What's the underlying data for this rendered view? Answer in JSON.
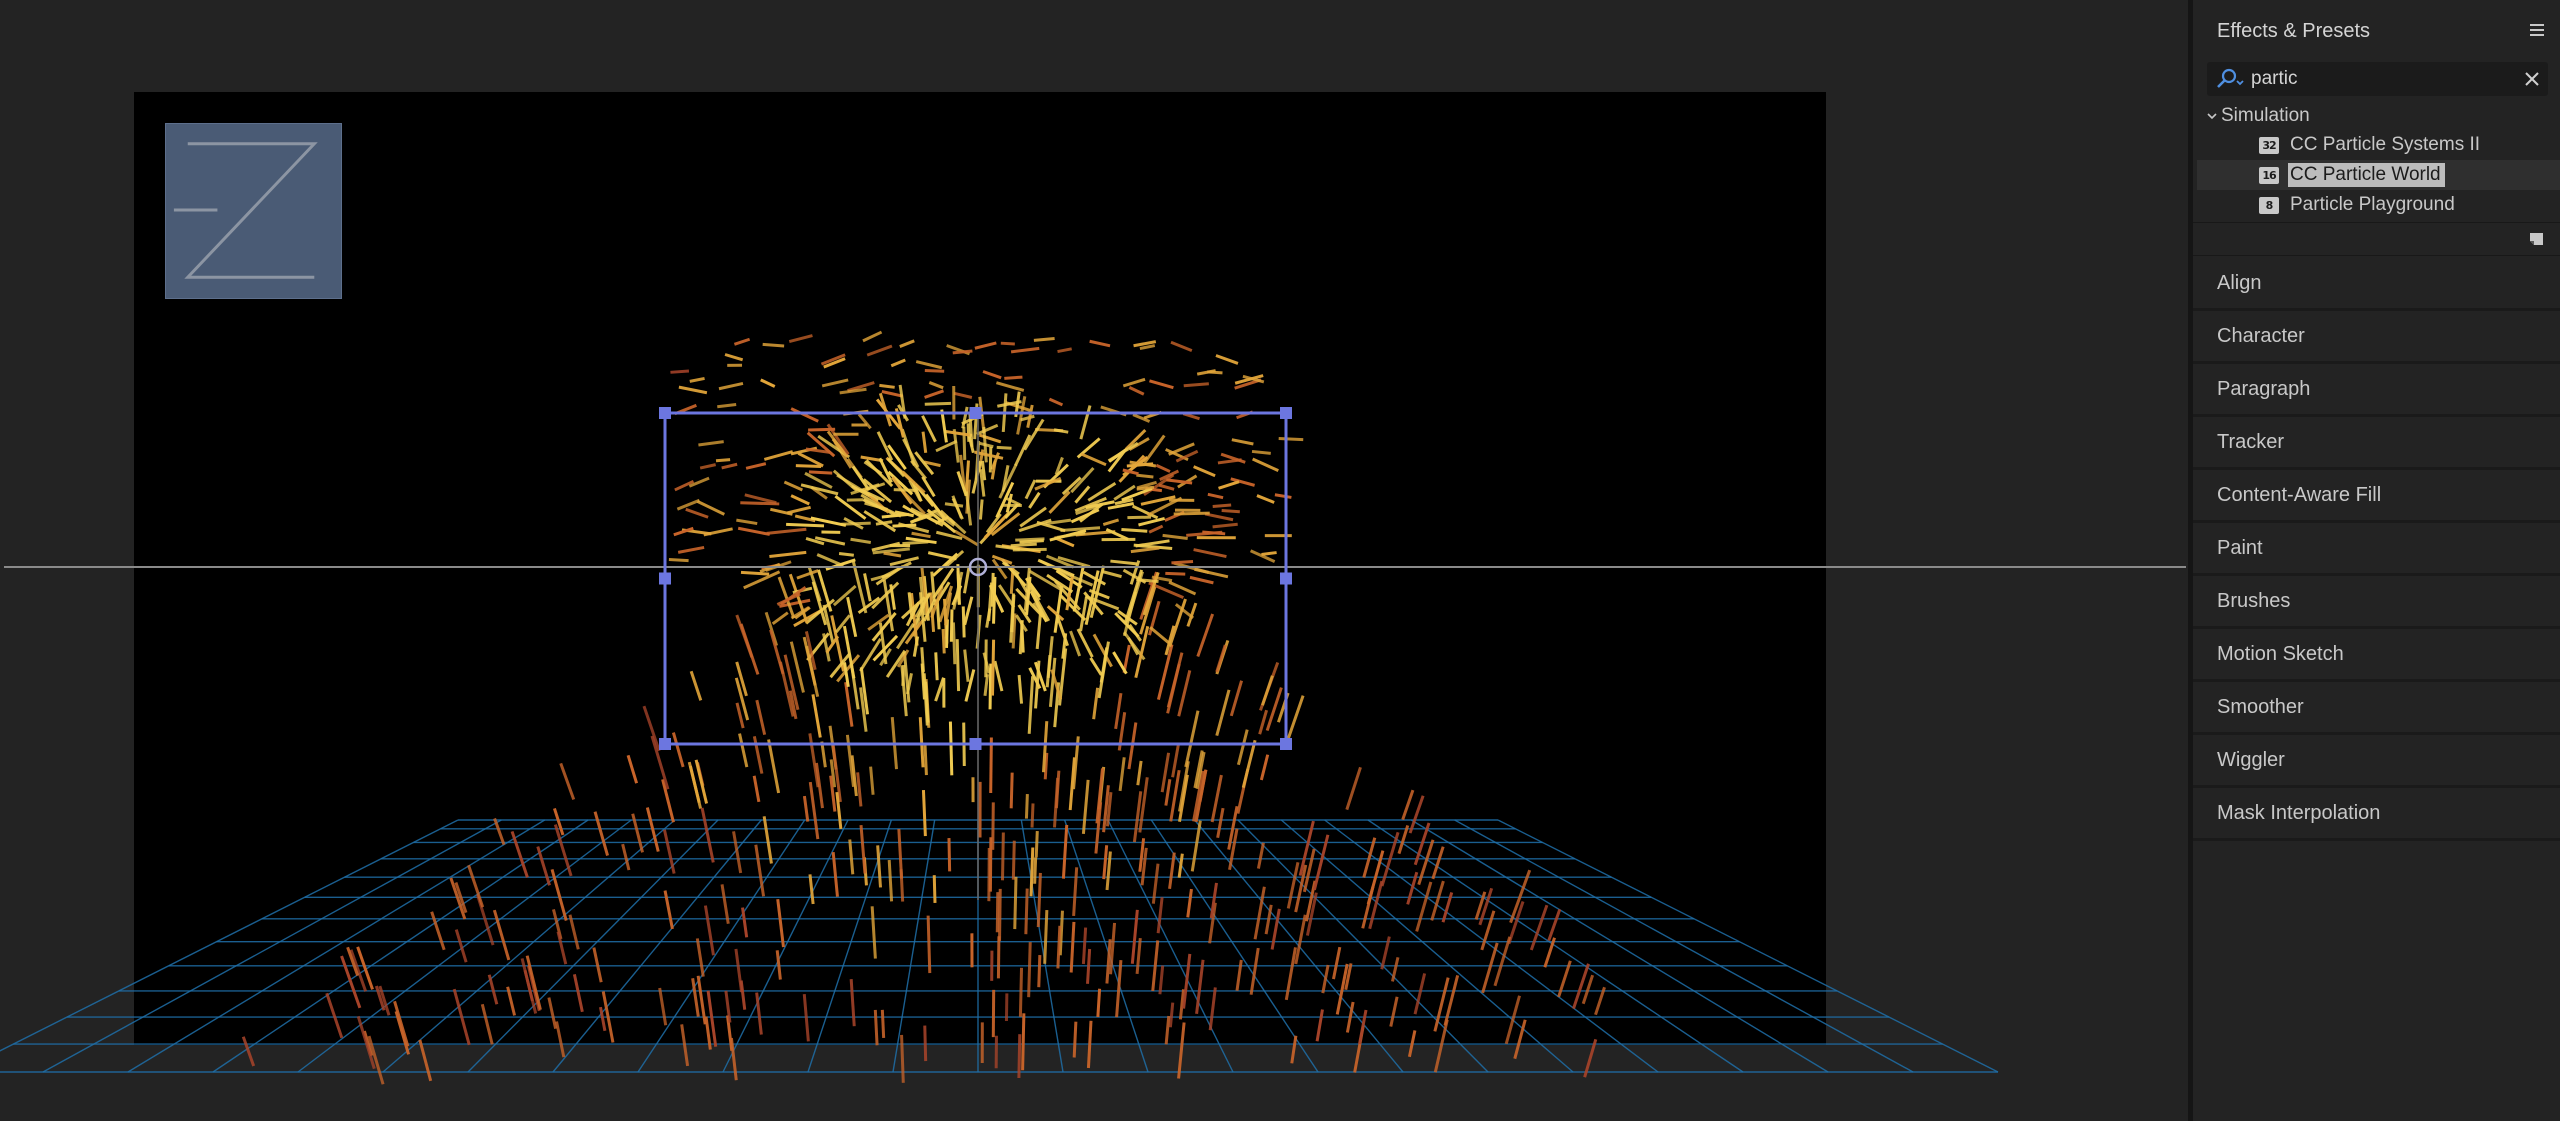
{
  "panel": {
    "title": "Effects & Presets",
    "menu_icon": "hamburger-icon",
    "search": {
      "value": "partic",
      "icon": "search-dropdown-icon",
      "clear_icon": "close-icon"
    },
    "tree": {
      "folder": "Simulation",
      "items": [
        {
          "label": "CC Particle Systems II",
          "badge": "32",
          "selected": false
        },
        {
          "label": "CC Particle World",
          "badge": "16",
          "selected": true
        },
        {
          "label": "Particle Playground",
          "badge": "8",
          "selected": false
        }
      ]
    },
    "footer_icon": "new-folder-icon"
  },
  "sections": [
    "Align",
    "Character",
    "Paragraph",
    "Tracker",
    "Content-Aware Fill",
    "Paint",
    "Brushes",
    "Motion Sketch",
    "Smoother",
    "Wiggler",
    "Mask Interpolation"
  ],
  "viewer": {
    "grid_color": "#1f6fa8",
    "selection_color": "#6c76e0",
    "particle_colors": [
      "#f2cd52",
      "#e3a63a",
      "#c8642a",
      "#a8442a"
    ],
    "logo_icon": "z-logo-icon"
  }
}
